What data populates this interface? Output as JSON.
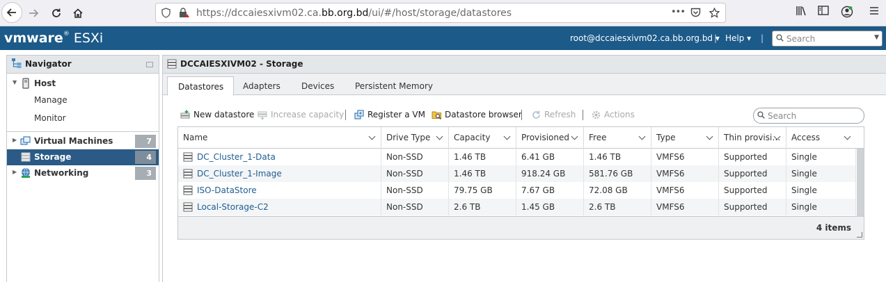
{
  "browser": {
    "url_prefix": "https://dccaiesxivm02.ca.",
    "url_host": "bb.org.bd",
    "url_path": "/ui/#/host/storage/datastores",
    "more_glyph": "•••"
  },
  "header": {
    "brand": "vmware",
    "product": "ESXi",
    "user": "root@dccaiesxivm02.ca.bb.org.bd ▾",
    "separator": "|",
    "help": "Help ▾",
    "search_placeholder": "Search"
  },
  "navigator": {
    "title": "Navigator",
    "items": [
      {
        "label": "Host",
        "badge": ""
      },
      {
        "label": "Manage",
        "badge": ""
      },
      {
        "label": "Monitor",
        "badge": ""
      },
      {
        "label": "Virtual Machines",
        "badge": "7"
      },
      {
        "label": "Storage",
        "badge": "4"
      },
      {
        "label": "Networking",
        "badge": "3"
      }
    ]
  },
  "main": {
    "title": "DCCAIESXIVM02 - Storage",
    "tabs": [
      {
        "label": "Datastores"
      },
      {
        "label": "Adapters"
      },
      {
        "label": "Devices"
      },
      {
        "label": "Persistent Memory"
      }
    ],
    "toolbar": {
      "new_datastore": "New datastore",
      "increase_capacity": "Increase capacity",
      "register_vm": "Register a VM",
      "datastore_browser": "Datastore browser",
      "refresh": "Refresh",
      "actions": "Actions",
      "search_placeholder": "Search"
    },
    "table": {
      "columns": [
        "Name",
        "Drive Type",
        "Capacity",
        "Provisioned",
        "Free",
        "Type",
        "Thin provisi…",
        "Access"
      ],
      "rows": [
        [
          "DC_Cluster_1-Data",
          "Non-SSD",
          "1.46 TB",
          "6.41 GB",
          "1.46 TB",
          "VMFS6",
          "Supported",
          "Single"
        ],
        [
          "DC_Cluster_1-Image",
          "Non-SSD",
          "1.46 TB",
          "918.24 GB",
          "581.76 GB",
          "VMFS6",
          "Supported",
          "Single"
        ],
        [
          "ISO-DataStore",
          "Non-SSD",
          "79.75 GB",
          "7.67 GB",
          "72.08 GB",
          "VMFS6",
          "Supported",
          "Single"
        ],
        [
          "Local-Storage-C2",
          "Non-SSD",
          "2.6 TB",
          "1.45 GB",
          "2.6 TB",
          "VMFS6",
          "Supported",
          "Single"
        ]
      ],
      "footer_count": "4 items"
    }
  },
  "colors": {
    "header_bg": "#1c5a89",
    "selected_nav": "#2a5a85",
    "link": "#1f5d92"
  }
}
